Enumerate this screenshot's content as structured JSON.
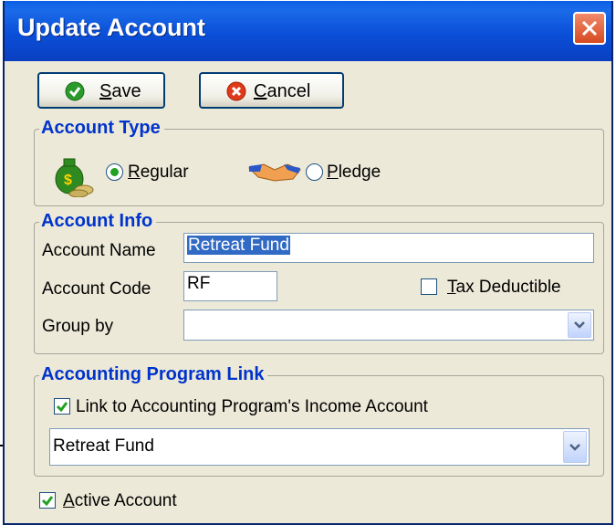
{
  "dialog": {
    "title": "Update Account"
  },
  "toolbar": {
    "save_prefix": "",
    "save_hotkey": "S",
    "save_rest": "ave",
    "cancel_hotkey": "C",
    "cancel_rest": "ancel"
  },
  "account_type": {
    "legend": "Account Type",
    "regular_hotkey": "R",
    "regular_rest": "egular",
    "pledge_hotkey": "P",
    "pledge_rest": "ledge",
    "selected": "Regular"
  },
  "account_info": {
    "legend": "Account Info",
    "name_label": "Account Name",
    "name_value": "Retreat Fund",
    "code_label": "Account Code",
    "code_value": "RF",
    "tax_hotkey": "T",
    "tax_rest": "ax Deductible",
    "tax_checked": false,
    "group_label": "Group by",
    "group_value": ""
  },
  "accounting_link": {
    "legend": "Accounting Program Link",
    "link_label": "Link to Accounting Program's Income Account",
    "link_checked": true,
    "income_account_value": "Retreat Fund"
  },
  "active": {
    "hotkey": "A",
    "rest": "ctive Account",
    "checked": true
  },
  "colors": {
    "title_bar": "#0a4fd8",
    "legend_text": "#0033cc",
    "check_green": "#21a121",
    "selection": "#316ac5"
  }
}
